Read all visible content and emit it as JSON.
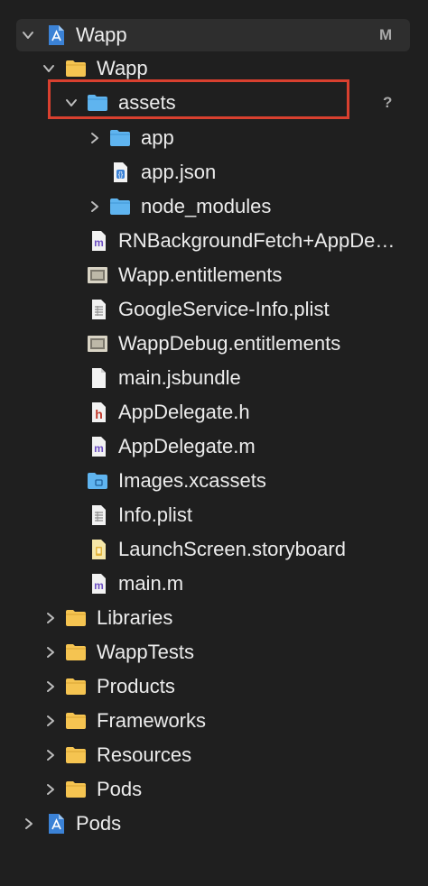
{
  "tree": {
    "root_project": {
      "label": "Wapp",
      "badge": "M",
      "icon": "xcode-project-icon"
    },
    "group_wapp": {
      "label": "Wapp",
      "icon": "folder-icon"
    },
    "assets": {
      "label": "assets",
      "badge": "?",
      "icon": "folder-icon"
    },
    "app": {
      "label": "app",
      "icon": "folder-icon"
    },
    "app_json": {
      "label": "app.json",
      "icon": "json-file-icon"
    },
    "node_modules": {
      "label": "node_modules",
      "icon": "folder-icon"
    },
    "files": [
      {
        "label": "RNBackgroundFetch+AppDelegate.m",
        "icon": "objc-m-file-icon"
      },
      {
        "label": "Wapp.entitlements",
        "icon": "entitlements-file-icon"
      },
      {
        "label": "GoogleService-Info.plist",
        "icon": "plist-file-icon"
      },
      {
        "label": "WappDebug.entitlements",
        "icon": "entitlements-file-icon"
      },
      {
        "label": "main.jsbundle",
        "icon": "file-icon"
      },
      {
        "label": "AppDelegate.h",
        "icon": "header-file-icon"
      },
      {
        "label": "AppDelegate.m",
        "icon": "objc-m-file-icon"
      },
      {
        "label": "Images.xcassets",
        "icon": "asset-catalog-icon"
      },
      {
        "label": "Info.plist",
        "icon": "plist-file-icon"
      },
      {
        "label": "LaunchScreen.storyboard",
        "icon": "storyboard-file-icon"
      },
      {
        "label": "main.m",
        "icon": "objc-m-file-icon"
      }
    ],
    "groups": [
      {
        "label": "Libraries"
      },
      {
        "label": "WappTests"
      },
      {
        "label": "Products"
      },
      {
        "label": "Frameworks"
      },
      {
        "label": "Resources"
      },
      {
        "label": "Pods"
      }
    ],
    "pods_project": {
      "label": "Pods",
      "icon": "xcode-project-icon"
    }
  },
  "colors": {
    "background": "#1f1f1f",
    "selected_row": "#2e2e2e",
    "highlight_border": "#d9402f",
    "folder_yellow": "#f5c451",
    "folder_blue": "#5fb4ef",
    "text": "#ececec",
    "badge": "#a8a8a8"
  }
}
